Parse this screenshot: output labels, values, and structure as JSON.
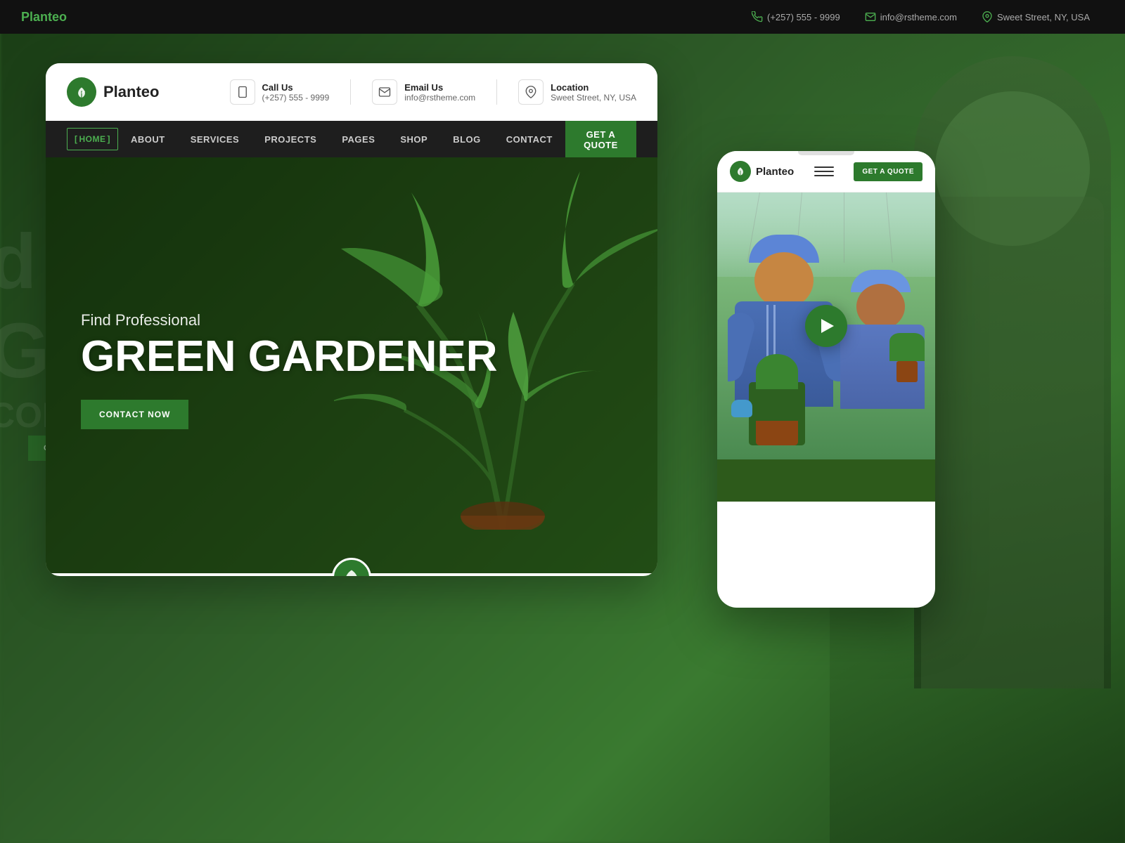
{
  "site": {
    "name": "Planteo",
    "tagline": "Green Gardener"
  },
  "topbar": {
    "phone_icon": "📞",
    "phone": "(+257) 555 - 9999",
    "email_icon": "✉",
    "email": "info@rstheme.com",
    "location_icon": "📍",
    "location": "Sweet Street, NY, USA"
  },
  "header": {
    "logo_alt": "Planteo leaf logo",
    "call_label": "Call Us",
    "call_number": "(+257) 555 - 9999",
    "email_label": "Email Us",
    "email_value": "info@rstheme.com",
    "location_label": "Location",
    "location_value": "Sweet Street, NY, USA"
  },
  "nav": {
    "items": [
      {
        "label": "HOME",
        "active": true
      },
      {
        "label": "ABOUT",
        "active": false
      },
      {
        "label": "SERVICES",
        "active": false
      },
      {
        "label": "PROJECTS",
        "active": false
      },
      {
        "label": "PAGES",
        "active": false
      },
      {
        "label": "SHOP",
        "active": false
      },
      {
        "label": "BLOG",
        "active": false
      },
      {
        "label": "CONTACT",
        "active": false
      }
    ],
    "cta_label": "GET A QUOTE"
  },
  "hero": {
    "subtitle": "Find Professional",
    "title": "GREEN GARDENER",
    "cta_label": "CONTACT NOW"
  },
  "mobile": {
    "logo_text": "Planteo",
    "cta_label": "GET A QUOTE"
  },
  "background": {
    "bleed_text_line1": "d F",
    "bleed_text_line2": "GRE",
    "bleed_text_line3": "CONT NO"
  },
  "colors": {
    "primary_green": "#2d7a2d",
    "dark_green": "#1a3d10",
    "nav_bg": "#1e1e1e",
    "text_dark": "#222222",
    "text_muted": "#666666"
  }
}
